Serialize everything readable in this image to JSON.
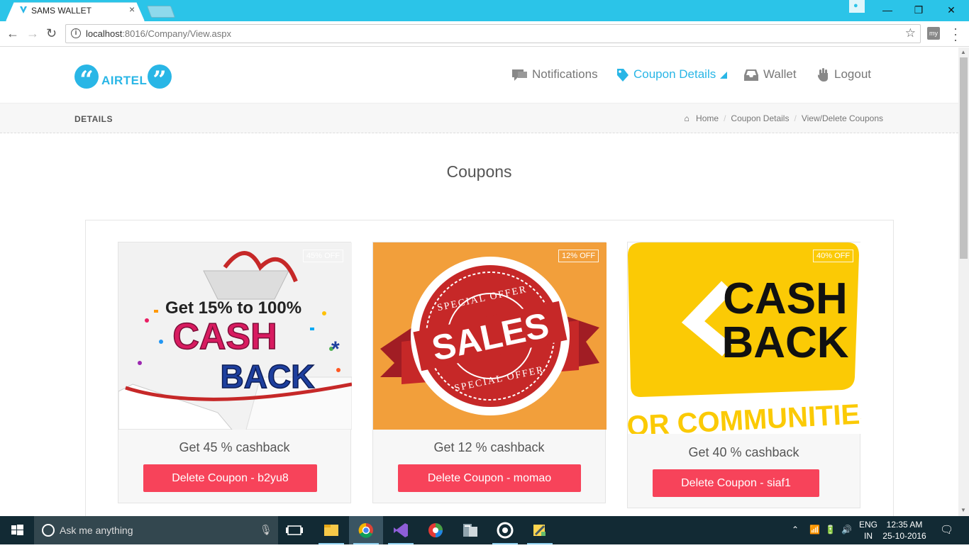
{
  "browser": {
    "tab_title": "SAMS WALLET",
    "tab_close": "×",
    "url_host": "localhost",
    "url_path": ":8016/Company/View.aspx",
    "ext_label": "my"
  },
  "header": {
    "logo_text": "AIRTEL",
    "menu": [
      {
        "label": "Notifications",
        "icon": "chat-icon",
        "active": false
      },
      {
        "label": "Coupon Details",
        "icon": "tag-icon",
        "active": true
      },
      {
        "label": "Wallet",
        "icon": "inbox-icon",
        "active": false
      },
      {
        "label": "Logout",
        "icon": "hand-icon",
        "active": false
      }
    ]
  },
  "breadbar": {
    "title": "DETAILS",
    "crumbs": [
      "Home",
      "Coupon Details",
      "View/Delete Coupons"
    ]
  },
  "section_title": "Coupons",
  "coupons": [
    {
      "badge": "45% OFF",
      "caption": "Get 45 % cashback",
      "button": "Delete Coupon - b2yu8",
      "art": {
        "line1": "Get 15% to 100%",
        "line2": "CASH",
        "line3": "BACK"
      }
    },
    {
      "badge": "12% OFF",
      "caption": "Get 12 % cashback",
      "button": "Delete Coupon - momao",
      "art": {
        "top": "SPECIAL OFFER",
        "main": "SALES",
        "bottom": "SPECIAL OFFER"
      }
    },
    {
      "badge": "40% OFF",
      "caption": "Get 40 % cashback",
      "button": "Delete Coupon - siaf1",
      "art": {
        "line1": "CASH",
        "line2": "BACK",
        "line3": "FOR COMMUNITIES"
      }
    }
  ],
  "taskbar": {
    "search_placeholder": "Ask me anything",
    "lang_top": "ENG",
    "lang_bottom": "IN",
    "time": "12:35 AM",
    "date": "25-10-2016"
  },
  "colors": {
    "brand": "#29b6e6",
    "delete_button": "#f7435a",
    "chrome_titlebar": "#2bc4e8",
    "taskbar": "#122a34"
  }
}
